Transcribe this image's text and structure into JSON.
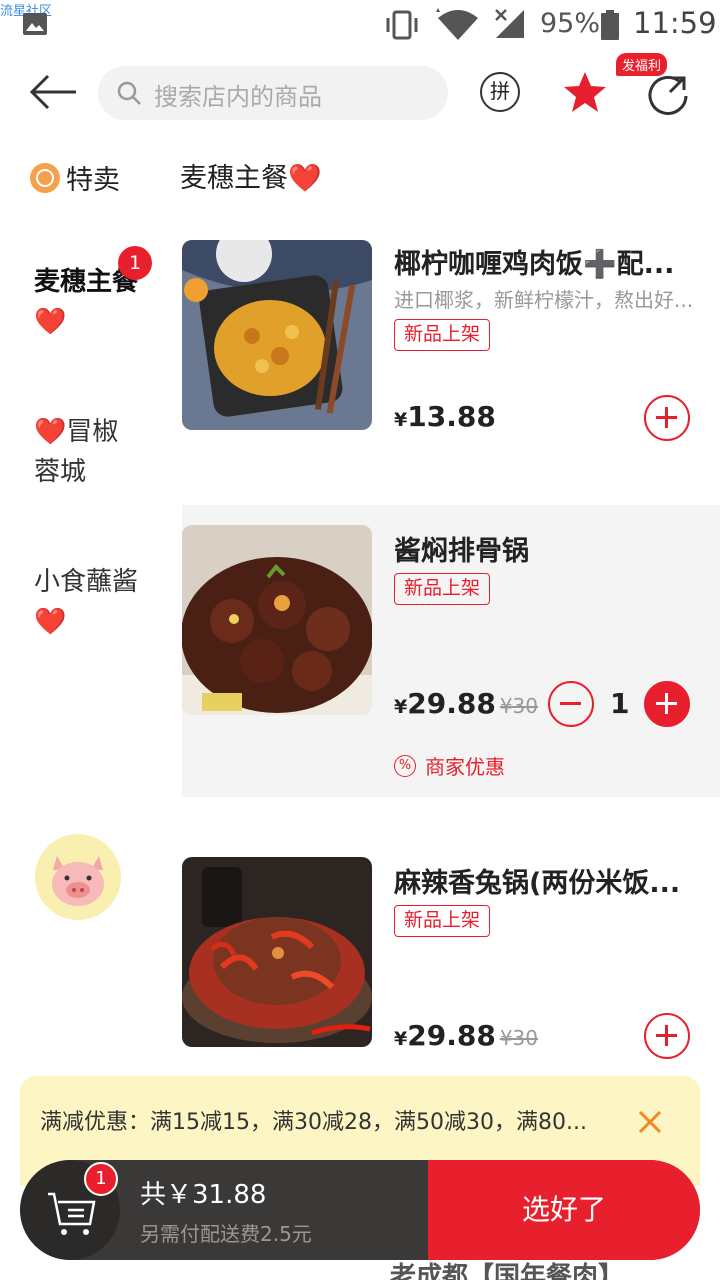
{
  "watermark": "流星社区",
  "status_bar": {
    "battery": "95%",
    "time": "11:59"
  },
  "header": {
    "search_placeholder": "搜索店内的商品",
    "pin_label": "拼",
    "fuli_badge": "发福利"
  },
  "tabs": [
    {
      "label": "特卖"
    },
    {
      "label": "麦穗主餐❤️"
    }
  ],
  "sidebar": {
    "items": [
      {
        "label_line1": "麦穗主餐",
        "label_line2": "❤️",
        "badge": "1"
      },
      {
        "label_line1": "❤️冒椒",
        "label_line2": "蓉城"
      },
      {
        "label_line1": "小食蘸酱",
        "label_line2": "❤️"
      }
    ]
  },
  "products": [
    {
      "name": "椰柠咖喱鸡肉饭➕配...",
      "desc": "进口椰浆，新鲜柠檬汁，熬出好...",
      "tag": "新品上架",
      "currency": "¥",
      "price": "13.88"
    },
    {
      "name": "酱焖排骨锅",
      "tag": "新品上架",
      "currency": "¥",
      "price": "29.88",
      "orig_price": "¥30",
      "qty": "1",
      "promo": "商家优惠"
    },
    {
      "name": "麻辣香兔锅(两份米饭...",
      "tag": "新品上架",
      "currency": "¥",
      "price": "29.88",
      "orig_price": "¥30"
    }
  ],
  "discount": {
    "text": "满减优惠：满15减15，满30减28，满50减30，满80..."
  },
  "cart": {
    "badge": "1",
    "total": "共￥31.88",
    "fee": "另需付配送费2.5元",
    "submit": "选好了"
  },
  "peek_text": "老成都【国年餐肉】"
}
